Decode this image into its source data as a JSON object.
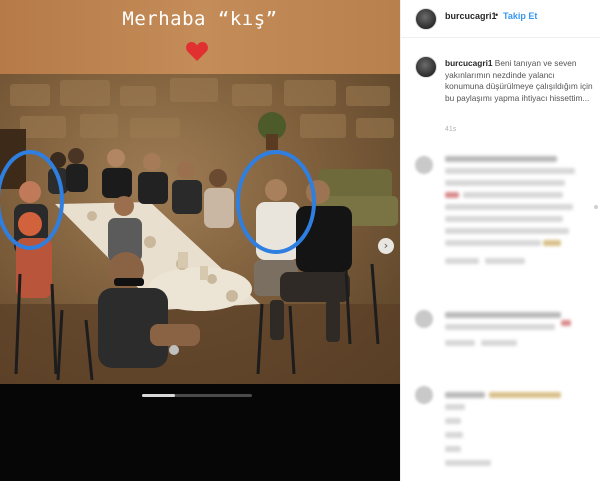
{
  "story": {
    "caption": "Merhaba “kış”",
    "heart_icon": "heart-emoji"
  },
  "post": {
    "carousel_progress": 0.3,
    "next_icon": "chevron-right-icon"
  },
  "header": {
    "username": "burcucagri1",
    "separator": "•",
    "follow_label": "Takip Et"
  },
  "caption": {
    "username": "burcucagri1",
    "text": " Beni tanıyan ve seven yakınlarımın nezdinde yalancı konumuna düşürülmeye çalışıldığım için bu paylaşımı yapma ihtiyacı hissettim...",
    "age": "41s"
  },
  "colors": {
    "link": "#3897f0",
    "banner": "#c48c58",
    "circle": "#2f7fe0"
  }
}
